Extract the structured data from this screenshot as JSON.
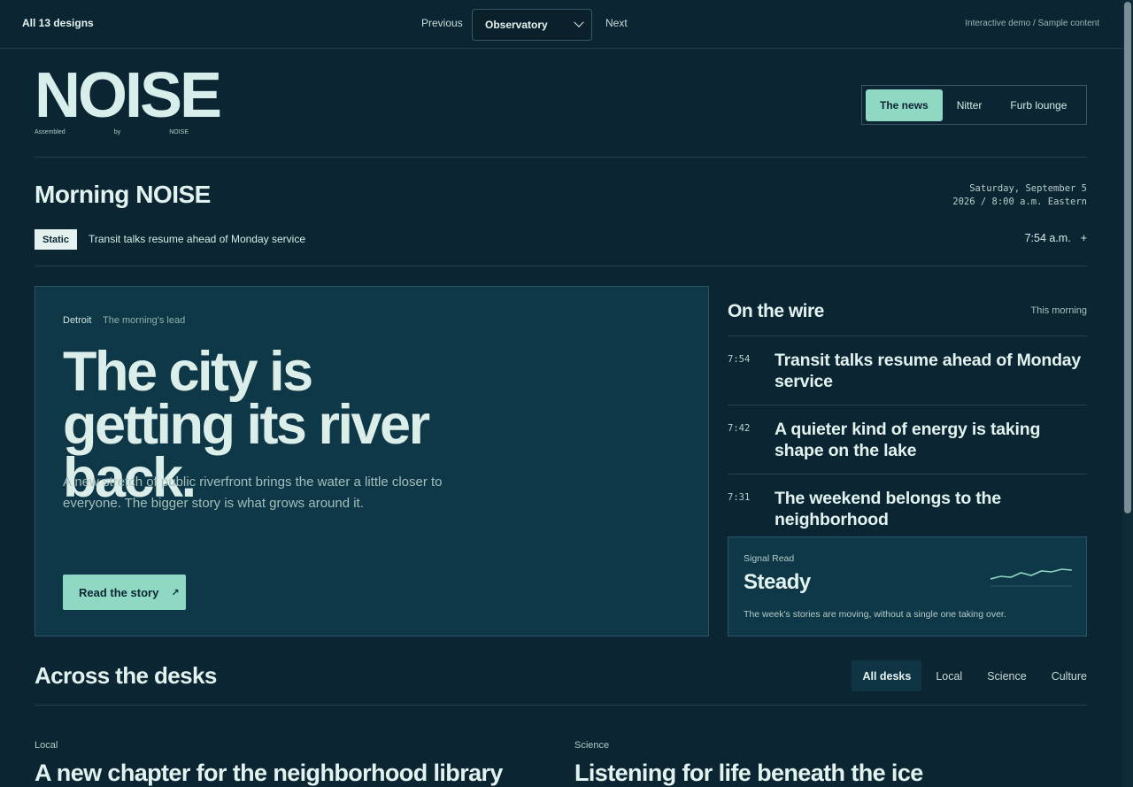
{
  "topbar": {
    "all_designs": "All 13 designs",
    "previous": "Previous",
    "selected_design": "Observatory",
    "next": "Next",
    "note": "Interactive demo / Sample content"
  },
  "masthead": {
    "logo": "NOISE",
    "sub": [
      "Assembled",
      "by",
      "NOISE"
    ],
    "sections": [
      "The news",
      "Nitter",
      "Furb lounge"
    ],
    "active_section": "The news"
  },
  "edition": {
    "title": "Morning NOISE",
    "date_line1": "Saturday, September 5",
    "date_line2": "2026 / 8:00 a.m. Eastern",
    "ticker_badge": "Static",
    "ticker_text": "Transit talks resume ahead of Monday service",
    "ticker_time": "7:54 a.m.",
    "ticker_plus": "+"
  },
  "lead": {
    "place": "Detroit",
    "kicker": "The morning's lead",
    "headline": "The city is getting its river back.",
    "dek": "A new stretch of public riverfront brings the water a little closer to everyone. The bigger story is what grows around it.",
    "cta": "Read the story",
    "cta_icon": "↗"
  },
  "wire": {
    "title": "On the wire",
    "meta": "This morning",
    "items": [
      {
        "time": "7:54",
        "headline": "Transit talks resume ahead of Monday service"
      },
      {
        "time": "7:42",
        "headline": "A quieter kind of energy is taking shape on the lake"
      },
      {
        "time": "7:31",
        "headline": "The weekend belongs to the neighborhood"
      }
    ]
  },
  "signal": {
    "label": "Signal Read",
    "value": "Steady",
    "desc": "The week's stories are moving, without a single one taking over.",
    "sparkline": [
      0.4,
      0.55,
      0.5,
      0.75,
      0.6,
      0.85,
      0.8,
      0.95,
      0.9
    ],
    "accent": "#8fd8c4"
  },
  "desks": {
    "title": "Across the desks",
    "tabs": [
      "All desks",
      "Local",
      "Science",
      "Culture"
    ],
    "active_tab": "All desks",
    "stories": [
      {
        "desk": "Local",
        "headline": "A new chapter for the neighborhood library"
      },
      {
        "desk": "Science",
        "headline": "Listening for life beneath the ice"
      }
    ]
  },
  "colors": {
    "background": "#0b2532",
    "card": "#0e3848",
    "accent": "#8fd8c4",
    "text": "#e2f2ee"
  }
}
